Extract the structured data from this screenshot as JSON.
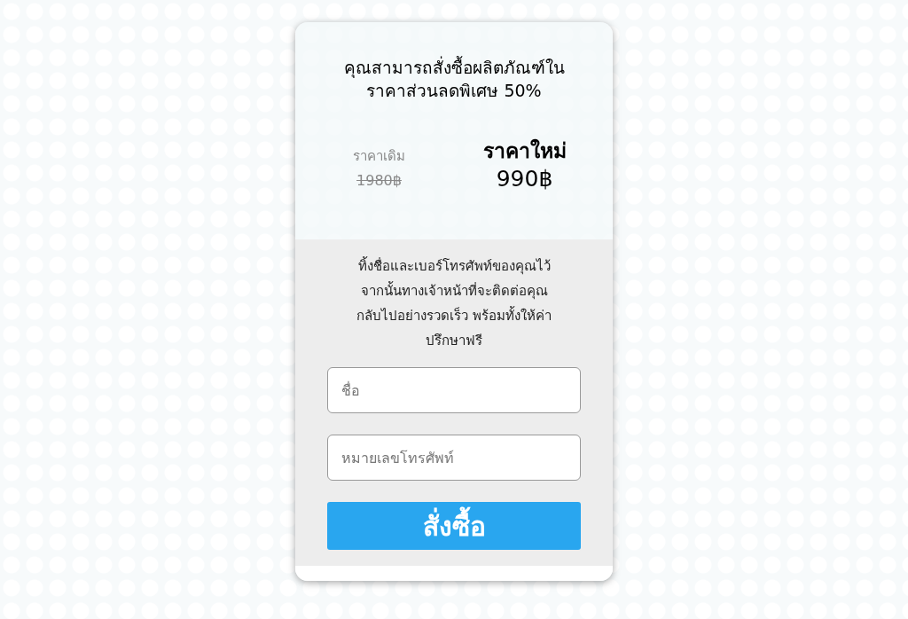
{
  "offer": {
    "headline_lines": [
      "คุณสามารถสั่งซื้อผลิตภัณฑ์ใน",
      "ราคาส่วนลดพิเศษ 50%"
    ],
    "old_price": {
      "label": "ราคาเดิม",
      "value": "1980฿"
    },
    "new_price": {
      "label": "ราคาใหม่",
      "value": "990฿"
    }
  },
  "form": {
    "intro_lines": [
      "ทิ้งชื่อและเบอร์โทรศัพท์ของคุณไว้",
      "จากนั้นทางเจ้าหน้าที่จะติดต่อคุณ",
      "กลับไปอย่างรวดเร็ว พร้อมทั้งให้ค่า",
      "ปรึกษาฟรี"
    ],
    "fields": [
      {
        "placeholder": "ชื่อ"
      },
      {
        "placeholder": "หมายเลขโทรศัพท์"
      }
    ],
    "submit": "สั่งซื้อ"
  }
}
